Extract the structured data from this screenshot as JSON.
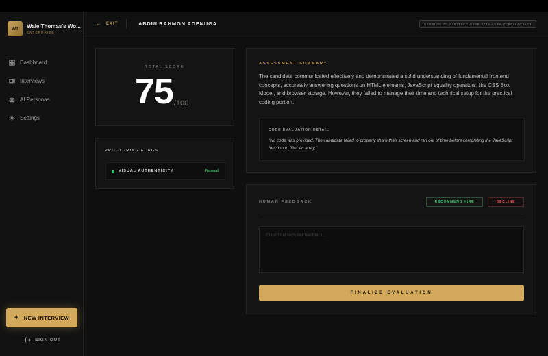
{
  "workspace": {
    "initials": "WT",
    "name": "Wale Thomas's Wo...",
    "plan": "ENTERPRISE"
  },
  "nav": [
    {
      "label": "Dashboard",
      "icon": "grid-icon"
    },
    {
      "label": "Interviews",
      "icon": "video-icon"
    },
    {
      "label": "AI Personas",
      "icon": "robot-icon"
    },
    {
      "label": "Settings",
      "icon": "gear-icon"
    }
  ],
  "new_interview_label": "NEW INTERVIEW",
  "sign_out_label": "SIGN OUT",
  "header": {
    "exit_label": "EXIT",
    "candidate_name": "ABDULRAHMON ADENUGA",
    "session_id": "SESSION ID: A487F6FC-E69B-4736-AE9A-7C6A284C3A79"
  },
  "score": {
    "label": "TOTAL SCORE",
    "value": "75",
    "max": "/100"
  },
  "proctoring": {
    "title": "PROCTORING FLAGS",
    "flags": [
      {
        "name": "VISUAL AUTHENTICITY",
        "status": "Normal"
      }
    ]
  },
  "summary": {
    "title": "ASSESSMENT SUMMARY",
    "text": "The candidate communicated effectively and demonstrated a solid understanding of fundamental frontend concepts, accurately answering questions on HTML elements, JavaScript equality operators, the CSS Box Model, and browser storage. However, they failed to manage their time and technical setup for the practical coding portion.",
    "code_title": "CODE EVALUATION DETAIL",
    "code_text": "\"No code was provided. The candidate failed to properly share their screen and ran out of time before completing the JavaScript function to filter an array.\""
  },
  "feedback": {
    "title": "HUMAN FEEDBACK",
    "recommend_label": "RECOMMEND HIRE",
    "decline_label": "DECLINE",
    "placeholder": "Enter final recruiter feedback...",
    "finalize_label": "FINALIZE EVALUATION"
  },
  "colors": {
    "accent": "#d3a95c",
    "success": "#3ec46d",
    "danger": "#d9534f"
  }
}
